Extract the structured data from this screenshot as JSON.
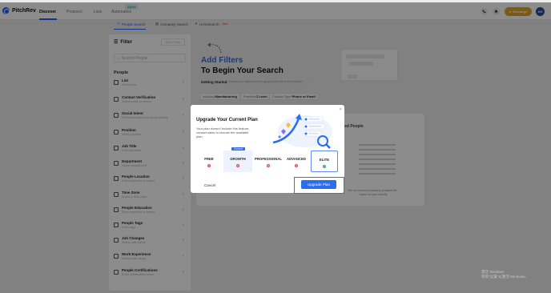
{
  "app": {
    "logo_text": "PitchRev"
  },
  "nav": [
    {
      "label": "Discover",
      "active": true
    },
    {
      "label": "Prospect",
      "active": false
    },
    {
      "label": "Lists",
      "active": false
    },
    {
      "label": "Automation",
      "active": false,
      "badge": "Alpha"
    }
  ],
  "topbar": {
    "recharge_label": "Recharge",
    "avatar_initials": "KH"
  },
  "subtabs": [
    {
      "label": "People Search",
      "active": true
    },
    {
      "label": "Company Search",
      "active": false
    },
    {
      "label": "AI Research",
      "active": false,
      "badge": "New"
    }
  ],
  "filter_panel": {
    "title": "Filter",
    "save_button": "Save Filter",
    "search_placeholder": "Search People",
    "section_title": "People",
    "items": [
      {
        "label": "List",
        "sub": "Select lists"
      },
      {
        "label": "Contact Verification",
        "sub": "Select email or phone"
      },
      {
        "label": "Social Intent",
        "sub": "Find leads based on social activity"
      },
      {
        "label": "Position",
        "sub": "Select position"
      },
      {
        "label": "Job Title",
        "sub": "Enter job titles"
      },
      {
        "label": "Department",
        "sub": "Select department"
      },
      {
        "label": "People Location",
        "sub": "Enter countries or states"
      },
      {
        "label": "Time Zone",
        "sub": "Select a time zone"
      },
      {
        "label": "People Education",
        "sub": "Enter countries or states"
      },
      {
        "label": "People Tags",
        "sub": "Enter tags"
      },
      {
        "label": "Job Changes",
        "sub": "Select date range"
      },
      {
        "label": "Work Experience",
        "sub": "Select date range"
      },
      {
        "label": "People Certifications",
        "sub": "Enter certification name"
      }
    ]
  },
  "main": {
    "add_filters": "Add Filters",
    "begin_search": "To Begin Your Search",
    "getting_started": "Getting Started",
    "getting_desc": "Narrow your results down by applying any filter in the left panel",
    "chips": [
      {
        "prefix": "Industry:",
        "value": "Manufacturing"
      },
      {
        "prefix": "Position:",
        "value": "C Level"
      },
      {
        "prefix": "Contact Type:",
        "value": "Phone or Email"
      }
    ],
    "recommended_title": "nded People",
    "recommended_text": "We recommend company prospect list - based on your activity"
  },
  "modal": {
    "title": "Upgrade Your Current Plan",
    "description": "Your plan doesn't include this feature, contact sales to choose the available plan.",
    "current_badge": "Current",
    "plans": [
      {
        "name": "FREE",
        "included": false
      },
      {
        "name": "GROWTH",
        "included": false,
        "current": true
      },
      {
        "name": "PROFESSIONAL",
        "included": false
      },
      {
        "name": "ADVANCED",
        "included": false
      },
      {
        "name": "ELITE",
        "included": true
      }
    ],
    "cancel_label": "Cancel",
    "upgrade_label": "Upgrade Plan"
  },
  "watermark": {
    "line1": "激活 Windows",
    "line2": "转到\"设置\"以激活 Windows。"
  },
  "colors": {
    "brand_blue": "#2b6cf0",
    "recharge": "#e2a526",
    "highlight_red": "#e23b3b",
    "elite_green": "#2db56a"
  }
}
